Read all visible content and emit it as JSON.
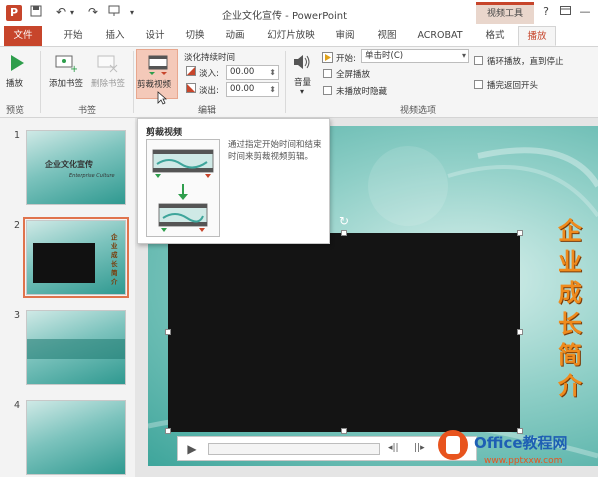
{
  "titlebar": {
    "document_title": "企业文化宣传 - PowerPoint",
    "contextual_tab_group": "视频工具",
    "help_label": "?",
    "app_letter": "P"
  },
  "tabs": [
    {
      "label": "文件"
    },
    {
      "label": "开始"
    },
    {
      "label": "插入"
    },
    {
      "label": "设计"
    },
    {
      "label": "切换"
    },
    {
      "label": "动画"
    },
    {
      "label": "幻灯片放映"
    },
    {
      "label": "审阅"
    },
    {
      "label": "视图"
    },
    {
      "label": "ACROBAT"
    },
    {
      "label": "格式"
    },
    {
      "label": "播放"
    }
  ],
  "ribbon": {
    "preview": {
      "play_label": "播放",
      "group_label": "预览"
    },
    "bookmarks": {
      "add_label": "添加书签",
      "remove_label": "删除书签",
      "group_label": "书签"
    },
    "editing": {
      "trim_label": "剪裁视频",
      "fade_duration_label": "淡化持续时间",
      "fade_in_label": "淡入:",
      "fade_in_value": "00.00",
      "fade_out_label": "淡出:",
      "fade_out_value": "00.00",
      "group_label": "编辑"
    },
    "video_options": {
      "volume_label": "音量",
      "start_label": "开始:",
      "start_value": "单击时(C)",
      "fullscreen_label": "全屏播放",
      "hide_label": "未播放时隐藏",
      "loop_label": "循环播放，直到停止",
      "rewind_label": "播完返回开头",
      "group_label": "视频选项"
    }
  },
  "tooltip": {
    "title": "剪裁视频",
    "description": "通过指定开始时间和结束时间来剪裁视频剪辑。"
  },
  "slides": [
    {
      "number": "1",
      "title": "企业文化宣传",
      "subtitle": "Enterprise Culture"
    },
    {
      "number": "2",
      "title": "企业成长简介"
    },
    {
      "number": "3"
    },
    {
      "number": "4"
    }
  ],
  "slide": {
    "vertical_title": "企业成长简介"
  },
  "watermark": {
    "brand": "Office教程网",
    "url": "www.pptxxw.com"
  },
  "colors": {
    "accent": "#c7452b",
    "slide_teal": "#3ea59b",
    "title_orange": "#ef8b1d"
  }
}
